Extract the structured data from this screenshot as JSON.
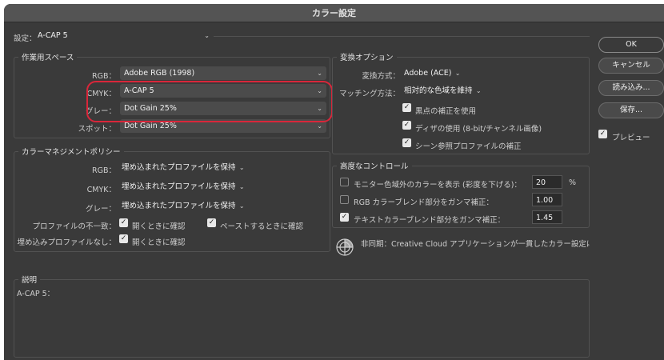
{
  "window": {
    "title": "カラー設定"
  },
  "settings": {
    "label": "設定：",
    "value": "A-CAP 5"
  },
  "workspace": {
    "title": "作業用スペース",
    "rgb_label": "RGB：",
    "rgb_value": "Adobe RGB (1998)",
    "cmyk_label": "CMYK：",
    "cmyk_value": "A-CAP 5",
    "gray_label": "グレー：",
    "gray_value": "Dot Gain 25%",
    "spot_label": "スポット：",
    "spot_value": "Dot Gain 25%"
  },
  "policy": {
    "title": "カラーマネジメントポリシー",
    "rgb_label": "RGB：",
    "rgb_value": "埋め込まれたプロファイルを保持",
    "cmyk_label": "CMYK：",
    "cmyk_value": "埋め込まれたプロファイルを保持",
    "gray_label": "グレー：",
    "gray_value": "埋め込まれたプロファイルを保持",
    "mismatch_label": "プロファイルの不一致：",
    "ask_open": "開くときに確認",
    "ask_paste": "ペーストするときに確認",
    "missing_label": "埋め込みプロファイルなし：",
    "ask_open2": "開くときに確認"
  },
  "conversion": {
    "title": "変換オプション",
    "engine_label": "変換方式：",
    "engine_value": "Adobe (ACE)",
    "intent_label": "マッチング方法：",
    "intent_value": "相対的な色域を維持",
    "bpc": "黒点の補正を使用",
    "dither": "ディザの使用 (8-bit/チャンネル画像)",
    "scene": "シーン参照プロファイルの補正"
  },
  "advanced": {
    "title": "高度なコントロール",
    "desaturate": "モニター色域外のカラーを表示 (彩度を下げる)：",
    "desaturate_value": "20",
    "desaturate_unit": "%",
    "rgb_blend": "RGB カラーブレンド部分をガンマ補正：",
    "rgb_blend_value": "1.00",
    "text_blend": "テキストカラーブレンド部分をガンマ補正：",
    "text_blend_value": "1.45"
  },
  "sync": {
    "text": "非同期：Creative Cloud アプリケーションが一貫したカラー設定に同…"
  },
  "description": {
    "title": "説明",
    "text": "A-CAP 5："
  },
  "buttons": {
    "ok": "OK",
    "cancel": "キャンセル",
    "load": "読み込み...",
    "save": "保存..."
  },
  "preview": {
    "label": "プレビュー"
  },
  "icons": {
    "chevron": "⌄",
    "check": "✓"
  },
  "colors": {
    "highlight": "#d9263a",
    "window_bg": "#3a3a3a"
  }
}
